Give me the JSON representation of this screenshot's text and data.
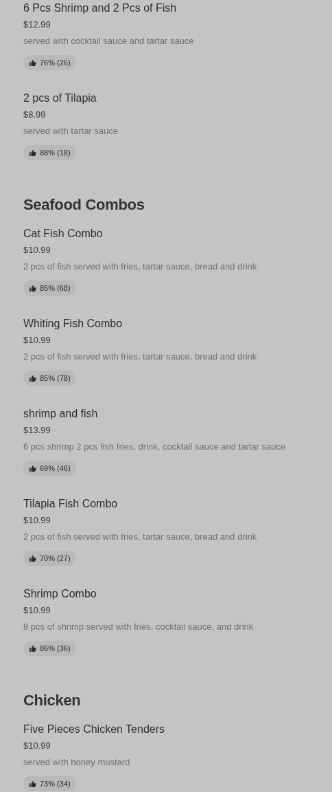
{
  "sections": [
    {
      "items": [
        {
          "name": "6 Pcs Shrimp and 2 Pcs of Fish",
          "price": "$12.99",
          "description": "served with cocktail sauce and tartar sauce",
          "rating": "76% (26)"
        },
        {
          "name": "2 pcs of Tilapia",
          "price": "$8.99",
          "description": "served with tartar sauce",
          "rating": "88% (18)"
        }
      ]
    },
    {
      "heading": "Seafood Combos",
      "items": [
        {
          "name": "Cat Fish Combo",
          "price": "$10.99",
          "description": "2 pcs of fish served with fries, tartar sauce, bread and drink",
          "rating": "85% (68)"
        },
        {
          "name": "Whiting Fish Combo",
          "price": "$10.99",
          "description": "2 pcs of fish served with fries, tartar sauce, bread and drink",
          "rating": "85% (78)"
        },
        {
          "name": "shrimp and fish",
          "price": "$13.99",
          "description": "6 pcs shrimp 2 pcs fish fries, drink, cocktail sauce and tartar sauce",
          "rating": "69% (46)"
        },
        {
          "name": "Tilapia Fish Combo",
          "price": "$10.99",
          "description": "2 pcs of fish served with fries, tartar sauce, bread and drink",
          "rating": "70% (27)"
        },
        {
          "name": "Shrimp Combo",
          "price": "$10.99",
          "description": "8 pcs of shrimp served with fries, cocktail sauce, and drink",
          "rating": "86% (36)"
        }
      ]
    },
    {
      "heading": "Chicken",
      "items": [
        {
          "name": "Five Pieces Chicken Tenders",
          "price": "$10.99",
          "description": "served with honey mustard",
          "rating": "73% (34)"
        }
      ]
    }
  ]
}
